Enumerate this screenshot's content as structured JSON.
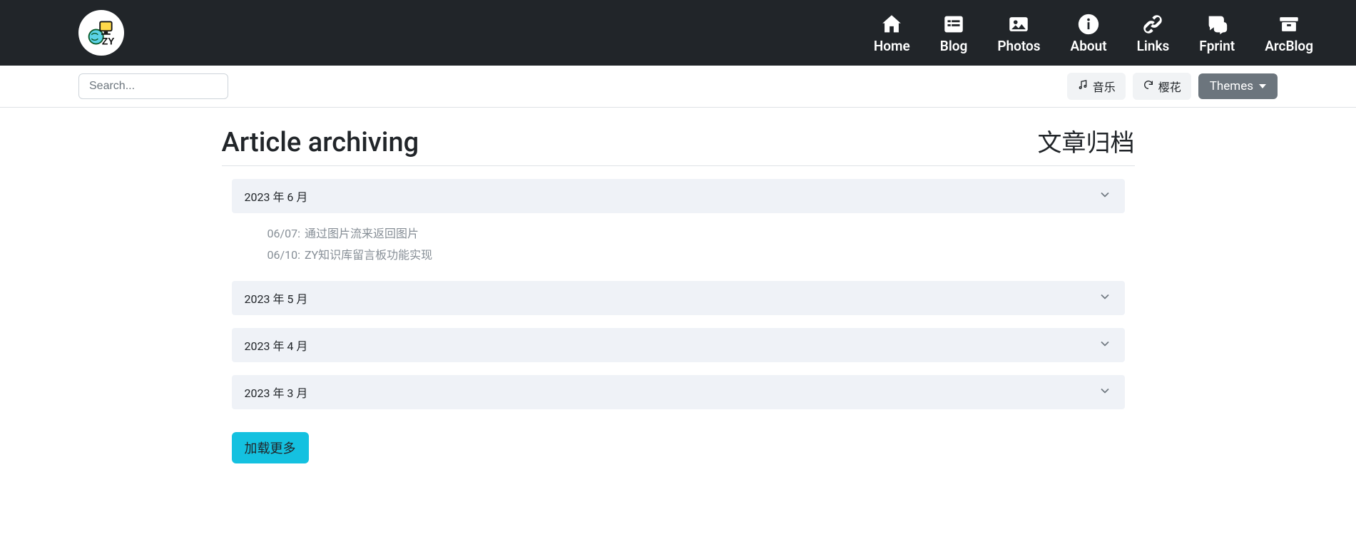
{
  "nav": {
    "home": "Home",
    "blog": "Blog",
    "photos": "Photos",
    "about": "About",
    "links": "Links",
    "fprint": "Fprint",
    "arcblog": "ArcBlog"
  },
  "toolbar": {
    "search_placeholder": "Search...",
    "music": "音乐",
    "sakura": "樱花",
    "themes": "Themes"
  },
  "page": {
    "title_en": "Article archiving",
    "title_cn": "文章归档"
  },
  "months": {
    "m0": {
      "label": "2023 年 6 月"
    },
    "m1": {
      "label": "2023 年 5 月"
    },
    "m2": {
      "label": "2023 年 4 月"
    },
    "m3": {
      "label": "2023 年 3 月"
    }
  },
  "articles": {
    "a0": {
      "date": "06/07:",
      "title": "通过图片流来返回图片"
    },
    "a1": {
      "date": "06/10:",
      "title": "ZY知识库留言板功能实现"
    }
  },
  "buttons": {
    "load_more": "加载更多"
  }
}
